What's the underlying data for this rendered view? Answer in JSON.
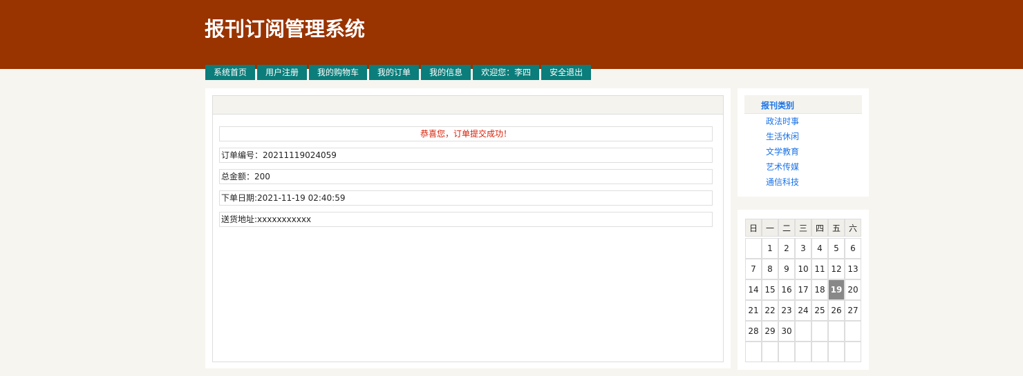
{
  "header": {
    "title": "报刊订阅管理系统"
  },
  "nav": {
    "items": [
      {
        "label": "系统首页"
      },
      {
        "label": "用户注册"
      },
      {
        "label": "我的购物车"
      },
      {
        "label": "我的订单"
      },
      {
        "label": "我的信息"
      },
      {
        "label": "欢迎您：李四"
      },
      {
        "label": "安全退出"
      }
    ]
  },
  "order": {
    "success_message": "恭喜您，订单提交成功！",
    "order_no": "订单编号：20211119024059",
    "total": "总金额：200",
    "date": "下单日期:2021-11-19 02:40:59",
    "address": "送货地址:xxxxxxxxxxx"
  },
  "sidebar": {
    "title": "报刊类别",
    "categories": [
      {
        "label": "政法时事"
      },
      {
        "label": "生活休闲"
      },
      {
        "label": "文学教育"
      },
      {
        "label": "艺术传媒"
      },
      {
        "label": "通信科技"
      }
    ]
  },
  "calendar": {
    "weekdays": [
      "日",
      "一",
      "二",
      "三",
      "四",
      "五",
      "六"
    ],
    "weeks": [
      [
        "",
        "1",
        "2",
        "3",
        "4",
        "5",
        "6"
      ],
      [
        "7",
        "8",
        "9",
        "10",
        "11",
        "12",
        "13"
      ],
      [
        "14",
        "15",
        "16",
        "17",
        "18",
        "19",
        "20"
      ],
      [
        "21",
        "22",
        "23",
        "24",
        "25",
        "26",
        "27"
      ],
      [
        "28",
        "29",
        "30",
        "",
        "",
        "",
        ""
      ],
      [
        "",
        "",
        "",
        "",
        "",
        "",
        ""
      ]
    ],
    "today": "19"
  },
  "colors": {
    "header_bg": "#993300",
    "nav_bg": "#0b7d7a",
    "success_text": "#d81e06",
    "link": "#1a73e8",
    "today_bg": "#888888"
  }
}
